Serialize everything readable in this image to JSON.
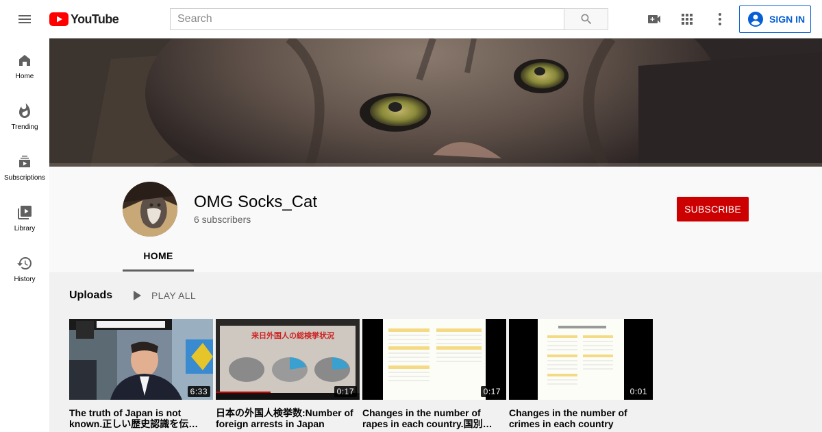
{
  "masthead": {
    "logo_text": "YouTube",
    "search_placeholder": "Search",
    "signin_label": "SIGN IN",
    "accent_red": "#ff0000",
    "accent_blue": "#065fd4"
  },
  "guide": {
    "items": [
      {
        "label": "Home",
        "icon": "home-icon"
      },
      {
        "label": "Trending",
        "icon": "trending-icon"
      },
      {
        "label": "Subscriptions",
        "icon": "subscriptions-icon"
      },
      {
        "label": "Library",
        "icon": "library-icon"
      },
      {
        "label": "History",
        "icon": "history-icon"
      }
    ]
  },
  "channel": {
    "name": "OMG Socks_Cat",
    "subscribers": "6 subscribers",
    "subscribe_label": "SUBSCRIBE",
    "subscribe_color": "#cc0000",
    "tabs": [
      {
        "label": "HOME",
        "selected": true
      }
    ]
  },
  "uploads": {
    "title": "Uploads",
    "play_all_label": "PLAY ALL",
    "videos": [
      {
        "title": "The truth of Japan is not known.正しい歴史認識を伝…",
        "duration": "6:33"
      },
      {
        "title": "日本の外国人検挙数:Number of foreign arrests in Japan",
        "duration": "0:17",
        "thumb_caption": "来日外国人の総検挙状況"
      },
      {
        "title": "Changes in the number of rapes in each country.国別…",
        "duration": "0:17"
      },
      {
        "title": "Changes in the number of crimes in each country",
        "duration": "0:01"
      }
    ]
  }
}
